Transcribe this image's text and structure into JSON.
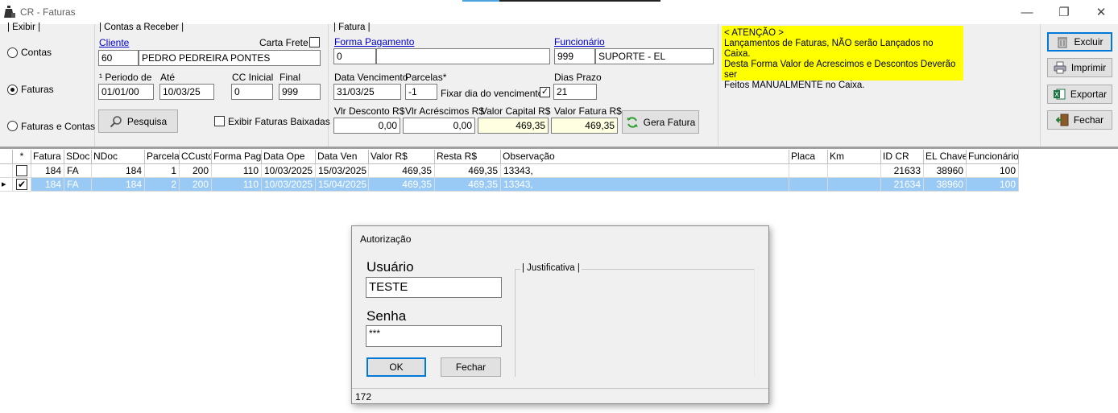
{
  "window": {
    "title": "CR - Faturas"
  },
  "exibir": {
    "group_label": "| Exibir |",
    "options": [
      {
        "label": "Contas",
        "selected": false
      },
      {
        "label": "Faturas",
        "selected": true
      },
      {
        "label": "Faturas e Contas",
        "selected": false
      }
    ]
  },
  "contas": {
    "group_label": "| Contas a Receber |",
    "cliente_label": "Cliente",
    "cliente_code": "60",
    "cliente_name": "PEDRO PEDREIRA PONTES",
    "carta_frete_label": "Carta Frete",
    "periodo_label": "¹ Periodo de",
    "ate_label": "Até",
    "cc_inicial_label": "CC Inicial",
    "final_label": "Final",
    "periodo_de": "01/01/00",
    "ate": "10/03/25",
    "cc_inicial": "0",
    "cc_final": "999",
    "pesquisa_label": "Pesquisa",
    "exibir_baixadas_label": "Exibir Faturas Baixadas"
  },
  "fatura": {
    "group_label": "| Fatura |",
    "forma_pagamento_label": "Forma Pagamento",
    "forma_pagamento_code": "0",
    "forma_pagamento_desc": "",
    "funcionario_label": "Funcionário",
    "funcionario_code": "999",
    "funcionario_name": "SUPORTE - EL",
    "data_vencimento_label": "Data Vencimento",
    "parcelas_label": "Parcelas*",
    "data_vencimento": "31/03/25",
    "parcelas": "-1",
    "fixar_label": "Fixar dia do vencimento",
    "fixar_checked": true,
    "dias_prazo_label": "Dias Prazo",
    "dias_prazo": "21",
    "vlr_desconto_label": "Vlr Desconto R$",
    "vlr_acrescimos_label": "Vlr Acréscimos R$",
    "valor_capital_label": "Valor Capital R$",
    "valor_fatura_label": "Valor Fatura R$",
    "vlr_desconto": "0,00",
    "vlr_acrescimos": "0,00",
    "valor_capital": "469,35",
    "valor_fatura": "469,35",
    "gera_fatura_label": "Gera Fatura"
  },
  "warning": {
    "title": "< ATENÇÃO >",
    "line1": "Lançamentos de Faturas, NÃO serão Lançados no Caixa.",
    "line2": "Desta Forma Valor de Acrescimos e Descontos Deverão ser",
    "line3": "Feitos MANUALMENTE no Caixa.",
    "color": "#ffff00"
  },
  "actions": {
    "excluir": "Excluir",
    "imprimir": "Imprimir",
    "exportar": "Exportar",
    "fechar": "Fechar"
  },
  "grid": {
    "columns": [
      "*",
      "Fatura",
      "SDoc",
      "NDoc",
      "Parcela",
      "CCusto",
      "Forma Pag",
      "Data Ope",
      "Data Ven",
      "Valor R$",
      "Resta R$",
      "Observação",
      "Placa",
      "Km",
      "ID CR",
      "EL Chave",
      "Funcionário"
    ],
    "rows": [
      {
        "checked": false,
        "selected": false,
        "fatura": "184",
        "sdoc": "FA",
        "ndoc": "184",
        "parcela": "1",
        "ccusto": "200",
        "forma_pag": "110",
        "data_ope": "10/03/2025",
        "data_ven": "15/03/2025",
        "valor": "469,35",
        "resta": "469,35",
        "obs": "13343,",
        "placa": "",
        "km": "",
        "id_cr": "21633",
        "el_chave": "38960",
        "funcionario": "100"
      },
      {
        "checked": true,
        "selected": true,
        "fatura": "184",
        "sdoc": "FA",
        "ndoc": "184",
        "parcela": "2",
        "ccusto": "200",
        "forma_pag": "110",
        "data_ope": "10/03/2025",
        "data_ven": "15/04/2025",
        "valor": "469,35",
        "resta": "469,35",
        "obs": "13343,",
        "placa": "",
        "km": "",
        "id_cr": "21634",
        "el_chave": "38960",
        "funcionario": "100"
      }
    ],
    "selection_color": "#99c9f5"
  },
  "dialog": {
    "title": "Autorização",
    "usuario_label": "Usuário",
    "usuario_value": "TESTE",
    "senha_label": "Senha",
    "senha_value": "***",
    "justificativa_label": "| Justificativa |",
    "ok_label": "OK",
    "fechar_label": "Fechar",
    "status": "172"
  }
}
